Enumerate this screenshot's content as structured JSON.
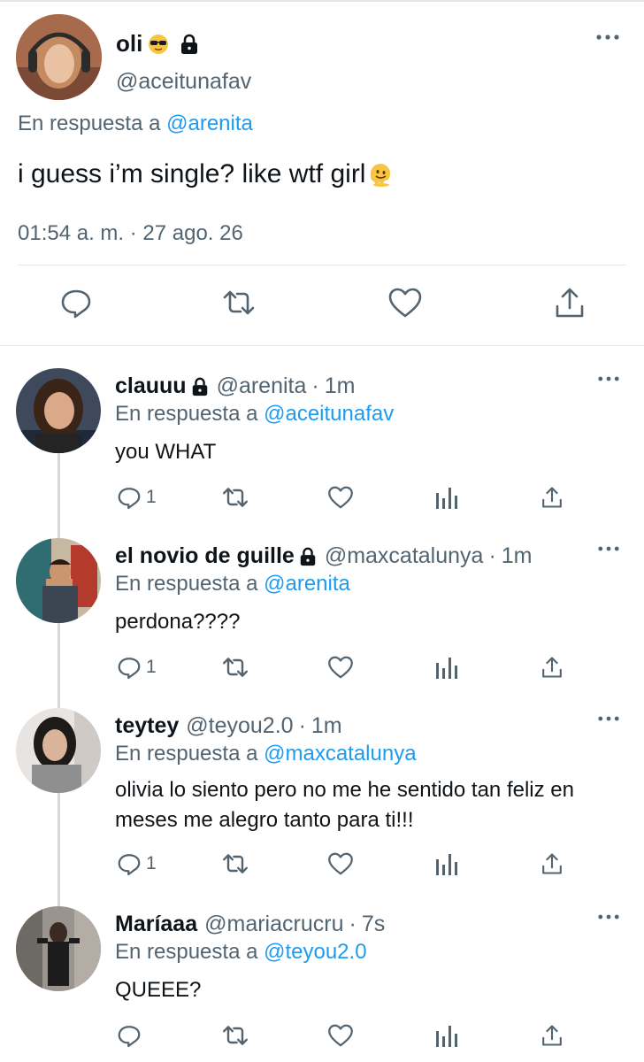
{
  "main_tweet": {
    "name": "oli",
    "handle": "@aceitunafav",
    "reply_prefix": "En respuesta a",
    "reply_to": "@arenita",
    "text": "i guess i’m single? like wtf girl",
    "timestamp": "01:54 a. m. · 27 ago. 26",
    "emoji_name": "sunglasses-emoji",
    "text_emoji_name": "melting-face-emoji"
  },
  "replies": [
    {
      "name": "clauuu",
      "locked": true,
      "handle": "@arenita",
      "time": "1m",
      "reply_prefix": "En respuesta a",
      "reply_to": "@aceitunafav",
      "text": "you WHAT",
      "reply_count": "1"
    },
    {
      "name": "el novio de guille",
      "locked": true,
      "handle": "@maxcatalunya",
      "time": "1m",
      "reply_prefix": "En respuesta a",
      "reply_to": "@arenita",
      "text": "perdona????",
      "reply_count": "1"
    },
    {
      "name": "teytey",
      "locked": false,
      "handle": "@teyou2.0",
      "time": "1m",
      "reply_prefix": "En respuesta a",
      "reply_to": "@maxcatalunya",
      "text": "olivia lo siento pero no me he sentido tan feliz en meses me alegro tanto para ti!!!",
      "reply_count": "1"
    },
    {
      "name": "Maríaaa",
      "locked": false,
      "handle": "@mariacrucru",
      "time": "7s",
      "reply_prefix": "En respuesta a",
      "reply_to": "@teyou2.0",
      "text": "QUEEE?",
      "reply_count": ""
    }
  ],
  "separator_dot": "·",
  "colors": {
    "link": "#1d9bf0",
    "secondary_text": "#536471",
    "primary_text": "#0f1419",
    "divider": "#e1e8ed",
    "thread_line": "#cfd9de"
  }
}
